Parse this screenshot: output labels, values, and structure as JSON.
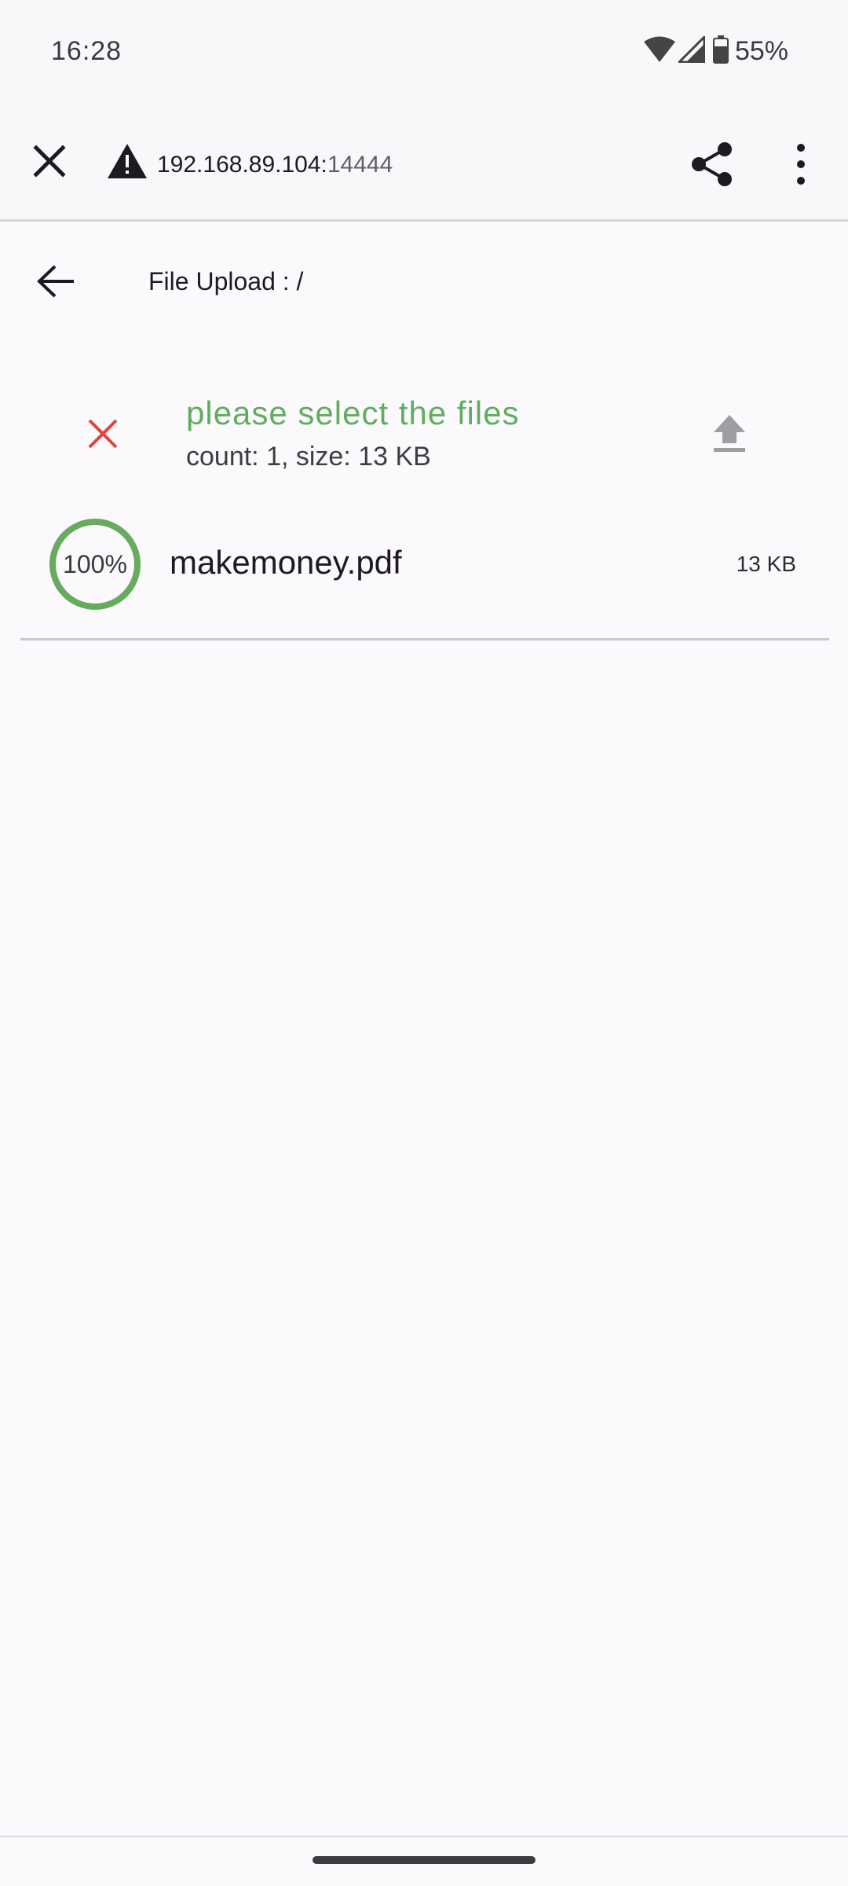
{
  "status_bar": {
    "time": "16:28",
    "battery": "55%",
    "icons": [
      "wifi-icon",
      "signal-icon",
      "battery-icon"
    ]
  },
  "browser": {
    "url_host": "192.168.89.104:",
    "url_port": "14444",
    "icons": [
      "close-icon",
      "warning-icon",
      "share-icon",
      "more-vert-icon"
    ]
  },
  "header": {
    "title": "File Upload : /"
  },
  "summary": {
    "title": "please select the files",
    "subtitle": "count: 1, size: 13 KB"
  },
  "files": [
    {
      "progress_label": "100%",
      "progress": 1.0,
      "name": "makemoney.pdf",
      "size": "13 KB"
    }
  ],
  "colors": {
    "accent_green": "#5fae5f",
    "cancel_red": "#e0443a",
    "background": "#fcf9fd"
  }
}
